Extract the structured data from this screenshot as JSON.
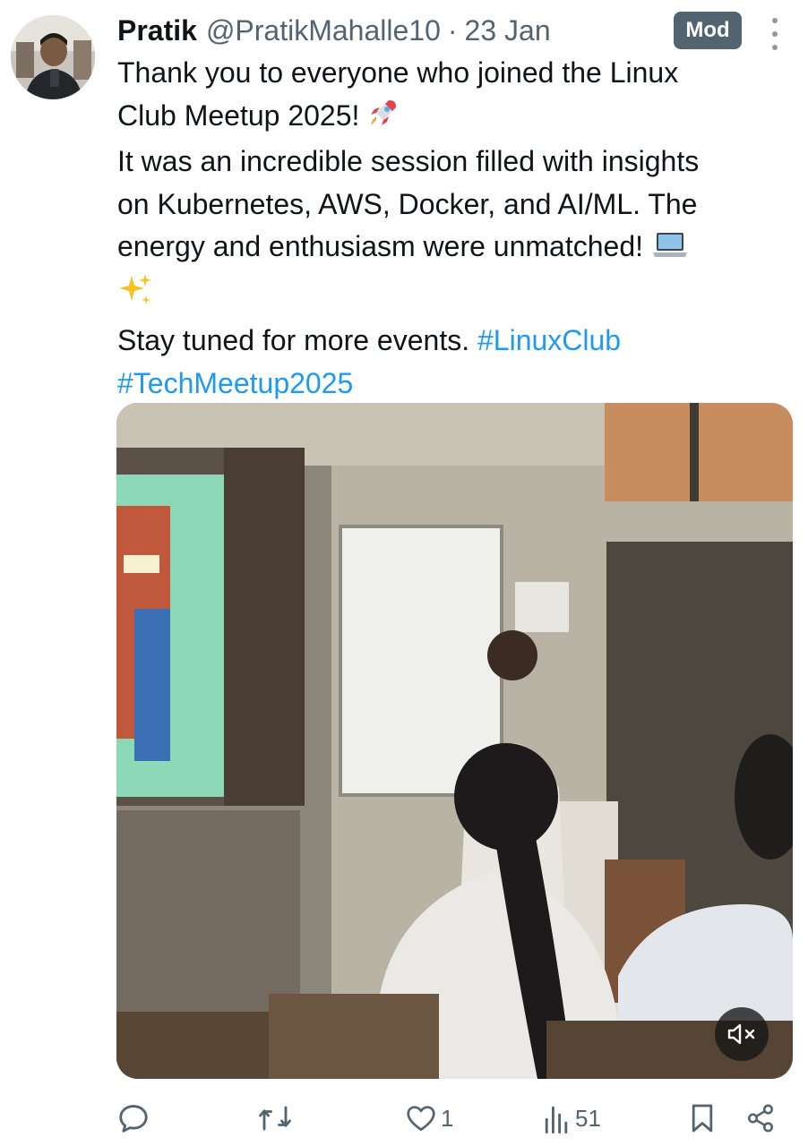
{
  "tweet": {
    "author_name": "Pratik",
    "handle": "@PratikMahalle10",
    "separator": "·",
    "date": "23 Jan",
    "badge": "Mod",
    "text_lines": [
      "Thank you to everyone who joined the Linux",
      "Club Meetup 2025! 🚀",
      "It was an incredible session filled with insights",
      "on Kubernetes, AWS, Docker, and AI/ML. The",
      "energy and enthusiasm were unmatched! 💻",
      "✨",
      "Stay tuned for more events. ",
      "#LinuxClub",
      "#TechMeetup2025"
    ],
    "line1": "Thank you to everyone who joined the Linux",
    "line2": "Club Meetup 2025! ",
    "line2_emoji": "rocket",
    "line3": "It was an incredible session filled with insights",
    "line4": "on Kubernetes, AWS, Docker, and AI/ML. The",
    "line5": "energy and enthusiasm were unmatched! ",
    "line5_emoji": "laptop",
    "line6_emoji": "sparkles",
    "line7": "Stay tuned for more events. ",
    "hashtag1": "#LinuxClub",
    "hashtag2": "#TechMeetup2025",
    "media": {
      "type": "video",
      "description_icon": "video-thumbnail",
      "mute_icon": "muted-speaker-icon"
    },
    "actions": {
      "reply_count": "",
      "retweet_count": "",
      "like_count": "1",
      "views_count": "51"
    }
  },
  "colors": {
    "text": "#0f1419",
    "secondary": "#536471",
    "link": "#1d9bf0",
    "badge_bg": "#536471"
  }
}
